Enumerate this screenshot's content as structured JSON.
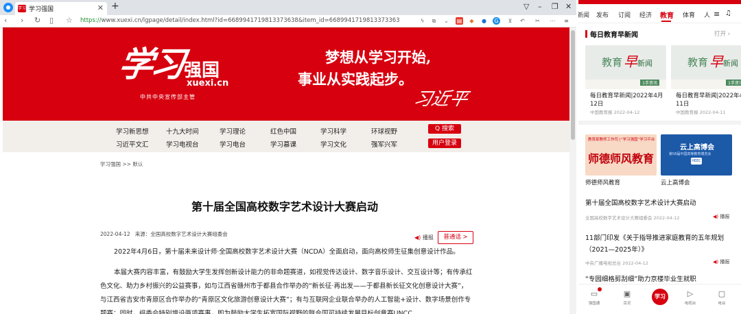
{
  "browser": {
    "tab_title": "学习强国",
    "tab_favicon_text": "学习",
    "new_tab": "+",
    "url_scheme": "https://",
    "url_rest": "www.xuexi.cn/lgpage/detail/index.html?id=6689941719813373638&item_id=6689941719813373363",
    "window_controls": [
      "▽",
      "–",
      "❐",
      "✕"
    ]
  },
  "site": {
    "logo_script": "学习",
    "logo_cn": "强国",
    "logo_en": "xuexi.cn",
    "logo_sub": "中共中央宣传部主管",
    "slogan_line1": "梦想从学习开始,",
    "slogan_line2": "事业从实践起步。",
    "signature": "习近平",
    "nav_row1": [
      "学习新思想",
      "十九大时间",
      "学习理论",
      "红色中国",
      "学习科学",
      "环球视野"
    ],
    "nav_row2": [
      "习近平文汇",
      "学习电视台",
      "学习电台",
      "学习慕课",
      "学习文化",
      "强军兴军"
    ],
    "search_button": "Q 搜索",
    "login_button": "用户登录"
  },
  "article": {
    "breadcrumb": "学习强国 >> 默认",
    "title": "第十届全国高校数字艺术设计大赛启动",
    "date": "2022-04-12",
    "source": "来源：全国高校数字艺术设计大赛组委会",
    "play_label": "播报",
    "font_label": "普通话 >",
    "para1": "2022年4月6日，第十届未来设计师·全国高校数字艺术设计大赛（NCDA）全面启动，面向高校师生征集创意设计作品。",
    "para2": "本届大赛内容丰富，有鼓励大学生发挥创新设计能力的非命题赛道，如视觉传达设计、数字音乐设计、交互设计等；有传承红色文化、助力乡村振兴的公益赛事，如与江西省赣州市于都县合作举办的“新长征·再出发——于都县新长征文化创意设计大赛”，与江西省吉安市青原区合作举办的“青原区文化旅游创意设计大赛”；有与互联网企业联合举办的人工智能+设计、数字场景创作专题赛；同时，组委会特别增设两项赛事，即为鼓励大学生拓宽国际视野的联合国可持续发展目标创意赛UNCC"
  },
  "phone": {
    "tabs": [
      "新闻",
      "发布",
      "订阅",
      "经济",
      "教育",
      "体育",
      "人"
    ],
    "active_tab": "教育",
    "menu_icon": "≡",
    "listen_icon": "♫",
    "section_title": "每日教育早新闻",
    "section_open": "打开 ›",
    "cards": [
      {
        "thumb_a": "教育",
        "thumb_b": "早",
        "thumb_c": "新闻",
        "badge": "1手资讯",
        "title": "每日教育早新闻|2022年4月12日",
        "meta": "中国教育报 2022-04-12"
      },
      {
        "thumb_a": "教育",
        "thumb_b": "早",
        "thumb_c": "新闻",
        "badge": "1手资讯",
        "title": "每日教育早新闻|2022年4月11日",
        "meta": "中国教育报 2022-04-11"
      }
    ],
    "banners": [
      {
        "small": "教育部教师工作司 |“学习强国”学习平台",
        "big": "师德师风教育",
        "label": "师德师风教育"
      },
      {
        "big": "云上高博会",
        "small": "第58届中国高等教育博览会",
        "logo": "HEEC",
        "label": "云上高博会"
      }
    ],
    "news": [
      {
        "title": "第十届全国高校数字艺术设计大赛启动",
        "src": "全国高校数字艺术设计大赛组委会 2022-04-12",
        "play": "播报"
      },
      {
        "title": "11部门印发《关于指导推进家庭教育的五年规划（2021—2025年）》",
        "src": "中央广播电视总台 2022-04-12",
        "play": "播报"
      },
      {
        "title": "“专园细格剪刮细”助力京楼毕业生就职",
        "src": "",
        "play": ""
      }
    ],
    "bottom_nav": [
      {
        "icon": "▭",
        "label": "强国通"
      },
      {
        "icon": "▣",
        "label": "百灵"
      },
      {
        "icon": "▷",
        "label": "电视台"
      },
      {
        "icon": "▢",
        "label": "电台"
      }
    ],
    "center_label": "学习"
  }
}
